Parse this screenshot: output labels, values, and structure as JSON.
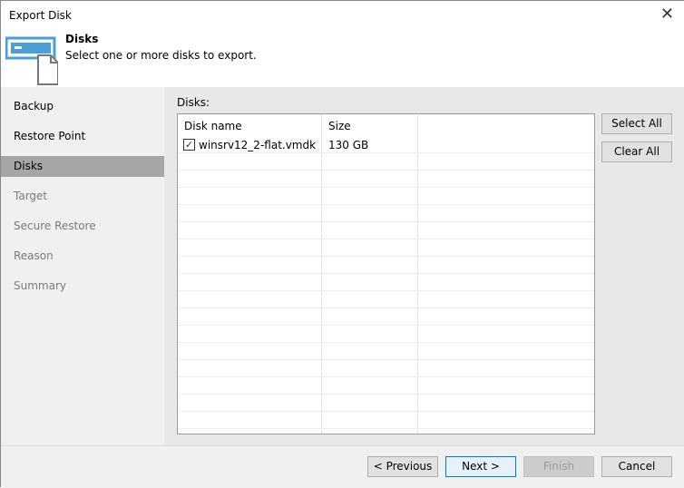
{
  "window": {
    "title": "Export Disk",
    "close_icon": "close-icon"
  },
  "header": {
    "title": "Disks",
    "subtitle": "Select one or more disks to export."
  },
  "nav": {
    "items": [
      {
        "label": "Backup"
      },
      {
        "label": "Restore Point"
      },
      {
        "label": "Disks"
      },
      {
        "label": "Target"
      },
      {
        "label": "Secure Restore"
      },
      {
        "label": "Reason"
      },
      {
        "label": "Summary"
      }
    ]
  },
  "main": {
    "label": "Disks:",
    "columns": [
      "Disk name",
      "Size"
    ],
    "rows": [
      {
        "name": "winsrv12_2-flat.vmdk",
        "size": "130 GB",
        "checked": true
      }
    ],
    "select_all": "Select All",
    "clear_all": "Clear All"
  },
  "footer": {
    "previous": "< Previous",
    "next": "Next >",
    "finish": "Finish",
    "cancel": "Cancel"
  }
}
